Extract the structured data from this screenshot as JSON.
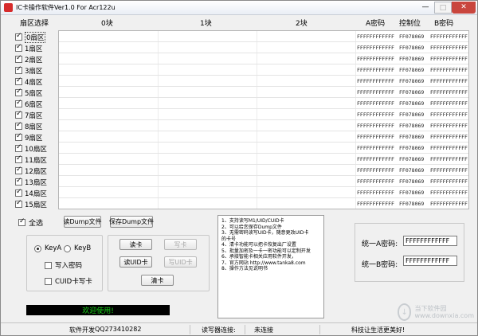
{
  "window": {
    "title": "IC卡操作软件Ver1.0 For Acr122u",
    "min": "—",
    "max": "□",
    "close": "✕"
  },
  "grid_header": {
    "sector_select": "扇区选择",
    "block0": "0块",
    "block1": "1块",
    "block2": "2块",
    "key_a": "A密码",
    "control": "控制位",
    "key_b": "B密码"
  },
  "sectors": [
    {
      "label": "0扇区",
      "checked": true,
      "key_a": "FFFFFFFFFFFF",
      "control": "FF078069",
      "key_b": "FFFFFFFFFFFF"
    },
    {
      "label": "1扇区",
      "checked": true,
      "key_a": "FFFFFFFFFFFF",
      "control": "FF078069",
      "key_b": "FFFFFFFFFFFF"
    },
    {
      "label": "2扇区",
      "checked": true,
      "key_a": "FFFFFFFFFFFF",
      "control": "FF078069",
      "key_b": "FFFFFFFFFFFF"
    },
    {
      "label": "3扇区",
      "checked": true,
      "key_a": "FFFFFFFFFFFF",
      "control": "FF078069",
      "key_b": "FFFFFFFFFFFF"
    },
    {
      "label": "4扇区",
      "checked": true,
      "key_a": "FFFFFFFFFFFF",
      "control": "FF078069",
      "key_b": "FFFFFFFFFFFF"
    },
    {
      "label": "5扇区",
      "checked": true,
      "key_a": "FFFFFFFFFFFF",
      "control": "FF078069",
      "key_b": "FFFFFFFFFFFF"
    },
    {
      "label": "6扇区",
      "checked": true,
      "key_a": "FFFFFFFFFFFF",
      "control": "FF078069",
      "key_b": "FFFFFFFFFFFF"
    },
    {
      "label": "7扇区",
      "checked": true,
      "key_a": "FFFFFFFFFFFF",
      "control": "FF078069",
      "key_b": "FFFFFFFFFFFF"
    },
    {
      "label": "8扇区",
      "checked": true,
      "key_a": "FFFFFFFFFFFF",
      "control": "FF078069",
      "key_b": "FFFFFFFFFFFF"
    },
    {
      "label": "9扇区",
      "checked": true,
      "key_a": "FFFFFFFFFFFF",
      "control": "FF078069",
      "key_b": "FFFFFFFFFFFF"
    },
    {
      "label": "10扇区",
      "checked": true,
      "key_a": "FFFFFFFFFFFF",
      "control": "FF078069",
      "key_b": "FFFFFFFFFFFF"
    },
    {
      "label": "11扇区",
      "checked": true,
      "key_a": "FFFFFFFFFFFF",
      "control": "FF078069",
      "key_b": "FFFFFFFFFFFF"
    },
    {
      "label": "12扇区",
      "checked": true,
      "key_a": "FFFFFFFFFFFF",
      "control": "FF078069",
      "key_b": "FFFFFFFFFFFF"
    },
    {
      "label": "13扇区",
      "checked": true,
      "key_a": "FFFFFFFFFFFF",
      "control": "FF078069",
      "key_b": "FFFFFFFFFFFF"
    },
    {
      "label": "14扇区",
      "checked": true,
      "key_a": "FFFFFFFFFFFF",
      "control": "FF078069",
      "key_b": "FFFFFFFFFFFF"
    },
    {
      "label": "15扇区",
      "checked": true,
      "key_a": "FFFFFFFFFFFF",
      "control": "FF078069",
      "key_b": "FFFFFFFFFFFF"
    }
  ],
  "controls": {
    "select_all": "全选",
    "read_dump": "读Dump文件",
    "save_dump": "保存Dump文件",
    "key_a": "KeyA",
    "key_b": "KeyB",
    "write_password": "写入密码",
    "cuid_write": "CUID卡写卡",
    "read_card": "读卡",
    "write_card": "写卡",
    "read_uid": "读UID卡",
    "write_uid": "写UID卡",
    "clear_card": "清卡",
    "welcome": "欢迎使用!"
  },
  "info_lines": [
    "1、支持读写M1/UID/CUID卡",
    "2、可以给您保存Dump文件",
    "3、无需密码读写UID卡，随意更改UID卡",
    "   的卡号",
    "4、清卡功能可以把卡恢复出厂设置",
    "5、批量加密及一卡一密功能可以定制开发",
    "6、承接智能卡相关应用软件开发，",
    "7、官方网站 http://www.tanka8.com",
    "8、操作方法见说明书"
  ],
  "keys": {
    "key_a_label": "统一A密码:",
    "key_a_value": "FFFFFFFFFFFF",
    "key_b_label": "统一B密码:",
    "key_b_value": "FFFFFFFFFFFF"
  },
  "footer": {
    "developer": "软件开发",
    "qq": "QQ273410282",
    "reader_label": "读写器连接:",
    "reader_status": "未连接",
    "slogan": "科技让生活更美好!"
  },
  "watermark": {
    "line1": "当下软件园",
    "line2": "www.downxia.com"
  }
}
